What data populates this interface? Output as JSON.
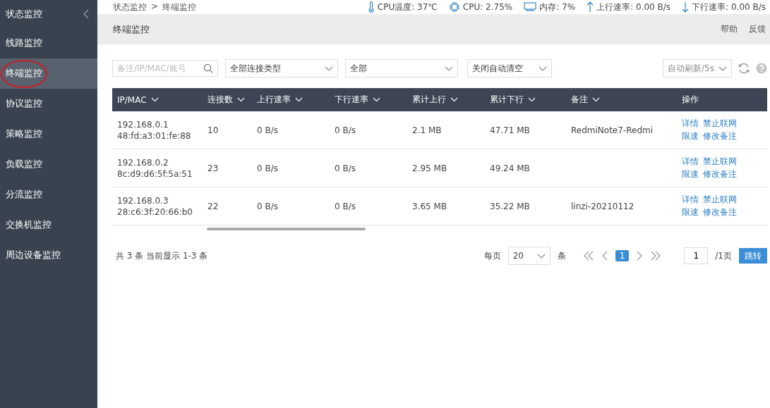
{
  "sidebar": {
    "title": "状态监控",
    "items": [
      {
        "label": "线路监控",
        "selected": false
      },
      {
        "label": "终端监控",
        "selected": true
      },
      {
        "label": "协议监控",
        "selected": false
      },
      {
        "label": "策略监控",
        "selected": false
      },
      {
        "label": "负载监控",
        "selected": false
      },
      {
        "label": "分流监控",
        "selected": false
      },
      {
        "label": "交换机监控",
        "selected": false
      },
      {
        "label": "周边设备监控",
        "selected": false
      }
    ]
  },
  "breadcrumb": {
    "items": [
      "状态监控",
      "终端监控"
    ],
    "separator": ">"
  },
  "status_bar": [
    {
      "kind": "temperature",
      "text": "CPU温度: 37℃"
    },
    {
      "kind": "cpu",
      "text": "CPU: 2.75%"
    },
    {
      "kind": "memory",
      "text": "内存: 7%"
    },
    {
      "kind": "upload",
      "text": "上行速率: 0.00 B/s"
    },
    {
      "kind": "download",
      "text": "下行速率: 0.00 B/s"
    }
  ],
  "page_title": "终端监控",
  "header_links": [
    "帮助",
    "反馈"
  ],
  "filters": {
    "search": {
      "placeholder": "备注/IP/MAC/账号"
    },
    "selects": [
      "全部连接类型",
      "全部",
      "关闭自动清空"
    ],
    "refresh": "自动刷新/5s"
  },
  "table": {
    "columns": [
      {
        "label": "IP/MAC",
        "sortable": true
      },
      {
        "label": "连接数",
        "sortable": true
      },
      {
        "label": "上行速率",
        "sortable": true
      },
      {
        "label": "下行速率",
        "sortable": true
      },
      {
        "label": "累计上行",
        "sortable": true
      },
      {
        "label": "累计下行",
        "sortable": true
      },
      {
        "label": "备注",
        "sortable": true
      },
      {
        "label": "操作",
        "sortable": false
      }
    ],
    "rows": [
      {
        "ip": "192.168.0.1",
        "mac": "48:fd:a3:01:fe:88",
        "connections": "10",
        "up_rate": "0 B/s",
        "down_rate": "0 B/s",
        "total_up": "2.1 MB",
        "total_down": "47.71 MB",
        "note": "RedmiNote7-Redmi",
        "actions": [
          "详情",
          "禁止联网",
          "限速",
          "修改备注"
        ]
      },
      {
        "ip": "192.168.0.2",
        "mac": "8c:d9:d6:5f:5a:51",
        "connections": "23",
        "up_rate": "0 B/s",
        "down_rate": "0 B/s",
        "total_up": "2.95 MB",
        "total_down": "49.24 MB",
        "actions": [
          "详情",
          "禁止联网",
          "限速",
          "修改备注"
        ]
      },
      {
        "ip": "192.168.0.3",
        "mac": "28:c6:3f:20:66:b0",
        "connections": "22",
        "up_rate": "0 B/s",
        "down_rate": "0 B/s",
        "total_up": "3.65 MB",
        "total_down": "35.22 MB",
        "note": "linzi-20210112",
        "actions": [
          "详情",
          "禁止联网",
          "限速",
          "修改备注"
        ]
      }
    ]
  },
  "pagination": {
    "summary": "共 3 条 当前显示 1-3 条",
    "per_page_label": "每页",
    "per_page": "20",
    "per_page_unit": "条",
    "pages": [
      {
        "label": "1",
        "selected": true
      }
    ],
    "page_input": "1",
    "total_pages": "/1页",
    "jump": "跳转"
  }
}
